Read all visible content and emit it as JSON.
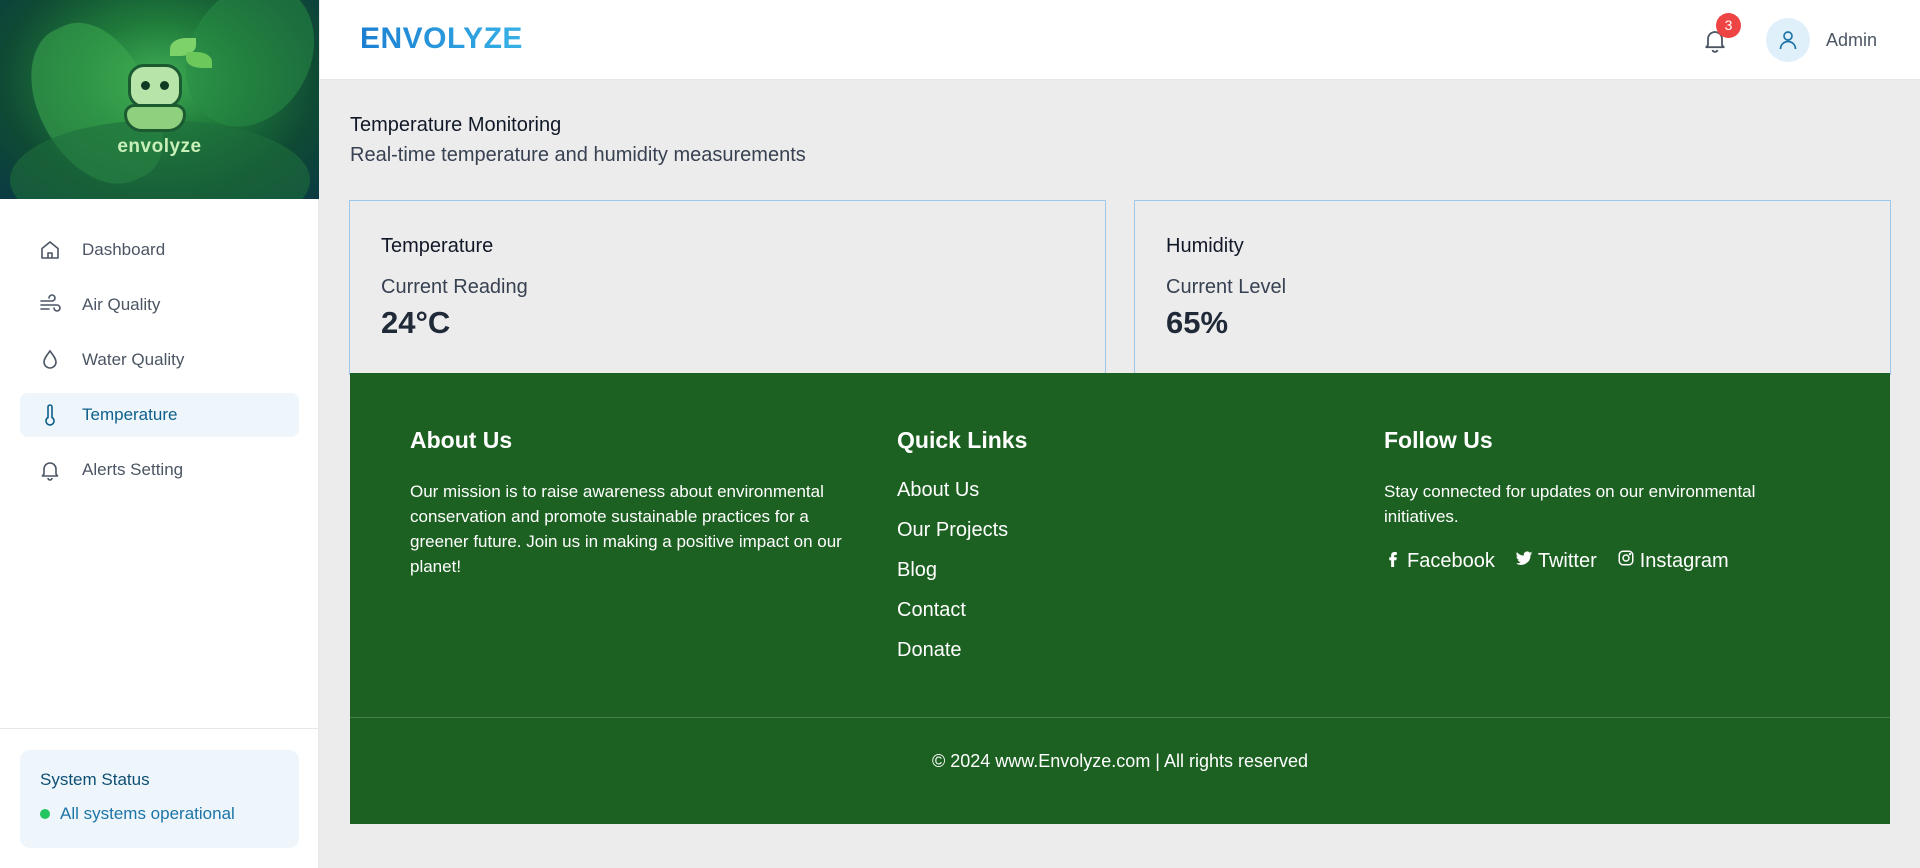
{
  "app": {
    "brand": "ENVOLYZE",
    "logo_text": "envolyze"
  },
  "header": {
    "notification_count": "3",
    "user_name": "Admin"
  },
  "sidebar": {
    "items": [
      {
        "label": "Dashboard",
        "icon": "home-icon"
      },
      {
        "label": "Air Quality",
        "icon": "wind-icon"
      },
      {
        "label": "Water Quality",
        "icon": "droplet-icon"
      },
      {
        "label": "Temperature",
        "icon": "thermometer-icon",
        "active": true
      },
      {
        "label": "Alerts Setting",
        "icon": "bell-icon"
      }
    ],
    "status": {
      "title": "System Status",
      "text": "All systems operational",
      "color": "#22c55e"
    }
  },
  "main": {
    "title": "Temperature Monitoring",
    "subtitle": "Real-time temperature and humidity measurements",
    "cards": {
      "temperature": {
        "title": "Temperature",
        "label": "Current Reading",
        "value": "24°C"
      },
      "humidity": {
        "title": "Humidity",
        "label": "Current Level",
        "value": "65%"
      }
    }
  },
  "footer": {
    "about": {
      "title": "About Us",
      "text": "Our mission is to raise awareness about environmental conservation and promote sustainable practices for a greener future. Join us in making a positive impact on our planet!"
    },
    "links": {
      "title": "Quick Links",
      "items": [
        "About Us",
        "Our Projects",
        "Blog",
        "Contact",
        "Donate"
      ]
    },
    "follow": {
      "title": "Follow Us",
      "text": "Stay connected for updates on our environmental initiatives.",
      "socials": [
        {
          "label": "Facebook",
          "icon": "facebook-icon"
        },
        {
          "label": "Twitter",
          "icon": "twitter-icon"
        },
        {
          "label": "Instagram",
          "icon": "instagram-icon"
        }
      ]
    },
    "copyright": "© 2024 www.Envolyze.com | All rights reserved"
  },
  "colors": {
    "accent": "#1b7fd1",
    "footer_bg": "#1d6122",
    "active_bg": "#eef6fc",
    "badge": "#ef4444"
  }
}
